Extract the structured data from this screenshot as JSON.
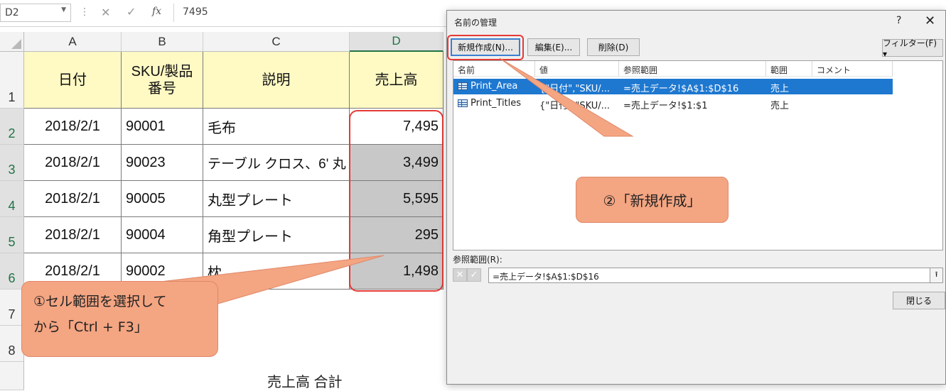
{
  "formula_bar": {
    "cell_ref": "D2",
    "separator": "⋮",
    "cancel_icon": "✕",
    "enter_icon": "✓",
    "fx_label": "fx",
    "value": "7495"
  },
  "sheet": {
    "columns": [
      "A",
      "B",
      "C",
      "D"
    ],
    "rows": [
      "1",
      "2",
      "3",
      "4",
      "5",
      "6",
      "7",
      "8"
    ],
    "headers": [
      "日付",
      "SKU/製品\n番号",
      "説明",
      "売上高"
    ],
    "data": [
      [
        "2018/2/1",
        "90001",
        "毛布",
        "7,495"
      ],
      [
        "2018/2/1",
        "90023",
        "テーブル クロス、6' 丸",
        "3,499"
      ],
      [
        "2018/2/1",
        "90005",
        "丸型プレート",
        "5,595"
      ],
      [
        "2018/2/1",
        "90004",
        "角型プレート",
        "295"
      ],
      [
        "2018/2/1",
        "90002",
        "枕",
        "1,498"
      ]
    ],
    "total_label": "売上高 合計"
  },
  "callouts": {
    "step1_line1": "①セル範囲を選択して",
    "step1_line2": "から「Ctrl + F3」",
    "step2": "②「新規作成」"
  },
  "dialog": {
    "title": "名前の管理",
    "help": "?",
    "close": "✕",
    "buttons": {
      "new": "新規作成(N)...",
      "edit": "編集(E)...",
      "delete": "削除(D)",
      "filter": "フィルター(F) ▾",
      "close": "閉じる"
    },
    "list_columns": [
      "名前",
      "値",
      "参照範囲",
      "範囲",
      "コメント"
    ],
    "list_rows": [
      {
        "name": "Print_Area",
        "value": "{\"日付\",\"SKU/...",
        "ref": "=売上データ!$A$1:$D$16",
        "scope": "売上",
        "comment": ""
      },
      {
        "name": "Print_Titles",
        "value": "{\"日付\",\"SKU/...",
        "ref": "=売上データ!$1:$1",
        "scope": "売上",
        "comment": ""
      }
    ],
    "ref_label": "参照範囲(R):",
    "ref_value": "=売上データ!$A$1:$D$16",
    "ref_cancel_icon": "✕",
    "ref_ok_icon": "✓",
    "ref_collapse_icon": "⭱"
  },
  "colors": {
    "header_fill": "#fff9c4",
    "selection_fill": "#c8c8c8",
    "callout_fill": "#f4a582",
    "highlight_border": "#e53935",
    "list_selection": "#1e78d0",
    "excel_green": "#217346"
  }
}
